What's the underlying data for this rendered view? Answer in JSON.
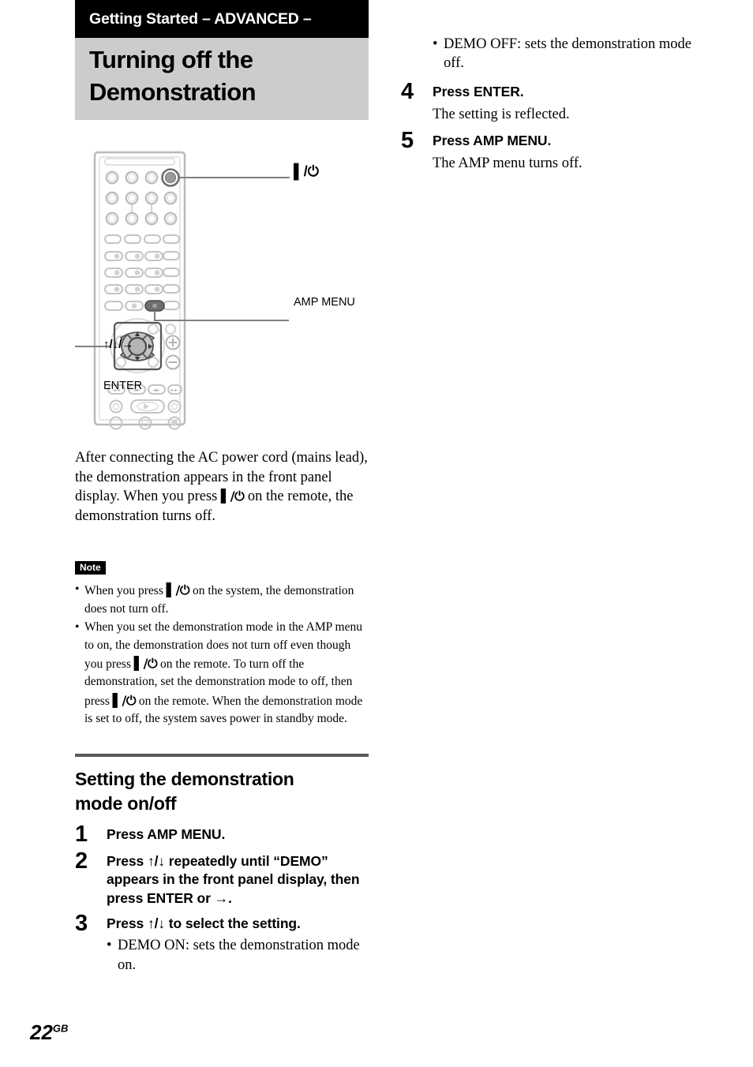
{
  "header": {
    "chapter": "Getting Started – ADVANCED –",
    "title_line1": "Turning off the",
    "title_line2": "Demonstration"
  },
  "figure": {
    "caption_power": "▌/⏻",
    "caption_amp_menu": "AMP MENU",
    "caption_arrows": "↑/↓/→",
    "caption_enter": "ENTER"
  },
  "intro": {
    "text_part1": "After connecting the AC power cord (mains lead), the demonstration appears in the front panel display. When you press ",
    "power_glyph": "▌/⏻",
    "text_part2": " on the remote, the demonstration turns off."
  },
  "note": {
    "tag": "Note",
    "items": [
      {
        "p1": "When you press ",
        "g1": "▌/⏻",
        "p2": " on the system, the demonstration does not turn off."
      },
      {
        "p1": "When you set the demonstration mode in the AMP menu to on, the demonstration does not turn off even though you press ",
        "g1": "▌/⏻",
        "p2": " on the remote. To turn off the demonstration, set the demonstration mode to off, then press ",
        "g2": "▌/⏻",
        "p3": " on the remote. When the demonstration mode is set to off, the system saves power in standby mode."
      }
    ]
  },
  "subsection": {
    "heading_line1": "Setting the demonstration",
    "heading_line2": "mode on/off"
  },
  "steps": [
    {
      "num": "1",
      "title": "Press AMP MENU.",
      "desc": "",
      "sublist": []
    },
    {
      "num": "2",
      "title": "Press ↑/↓ repeatedly until “DEMO” appears in the front panel display, then press ENTER or →.",
      "desc": "",
      "sublist": []
    },
    {
      "num": "3",
      "title": "Press ↑/↓ to select the setting.",
      "desc": "",
      "sublist": [
        "DEMO ON: sets the demonstration mode on."
      ]
    },
    {
      "num": "4",
      "title": "Press ENTER.",
      "desc": "The setting is reflected.",
      "sublist": []
    },
    {
      "num": "5",
      "title": "Press AMP MENU.",
      "desc": "The AMP menu turns off.",
      "sublist": []
    }
  ],
  "right_column_top_bullet": "DEMO OFF: sets the demonstration mode off.",
  "footer": {
    "page_number": "22",
    "region_code": "GB"
  },
  "colors": {
    "chapter_band": "#000000",
    "title_band": "#cccccc",
    "rule": "#595959",
    "remote_outline": "#b3b3b3",
    "remote_key": "#c8c8c8",
    "highlight_key": "#808080"
  }
}
